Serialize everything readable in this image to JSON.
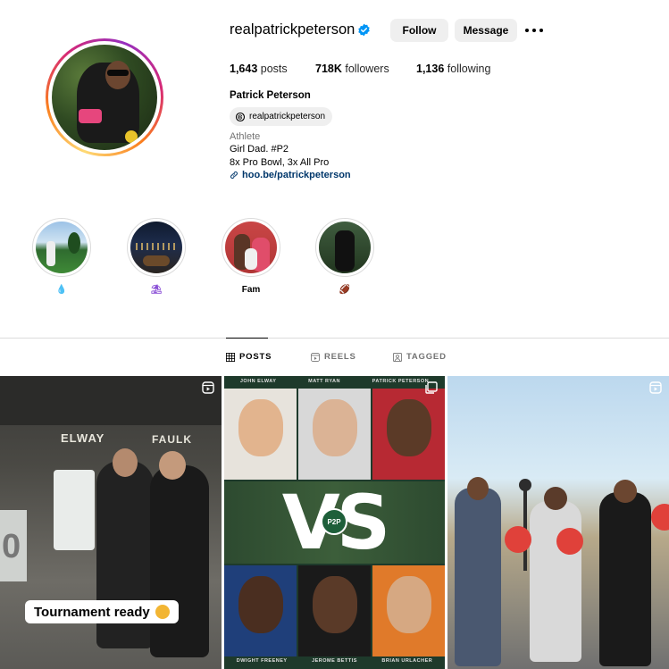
{
  "profile": {
    "username": "realpatrickpeterson",
    "verified": true,
    "follow_label": "Follow",
    "message_label": "Message",
    "stats": {
      "posts_count": "1,643",
      "posts_label": "posts",
      "followers_count": "718K",
      "followers_label": "followers",
      "following_count": "1,136",
      "following_label": "following"
    },
    "full_name": "Patrick Peterson",
    "threads_handle": "realpatrickpeterson",
    "category": "Athlete",
    "bio_line1": "Girl Dad. #P2",
    "bio_line2": "8x Pro Bowl, 3x All Pro",
    "link": "hoo.be/patrickpeterson"
  },
  "highlights": [
    {
      "label": "💧",
      "icon": "water-drop"
    },
    {
      "label": "⛱",
      "icon": "umbrella-emoji"
    },
    {
      "label": "Fam",
      "icon": "family-photo"
    },
    {
      "label": "🏈",
      "icon": "football-emoji"
    }
  ],
  "tabs": {
    "posts": "POSTS",
    "reels": "REELS",
    "tagged": "TAGGED",
    "active": "posts"
  },
  "posts": [
    {
      "type": "reel",
      "sign_left": "ELWAY",
      "sign_right": "FAULK",
      "wall_text": "0",
      "caption": "Tournament ready"
    },
    {
      "type": "reel",
      "top_names": [
        "JOHN ELWAY",
        "MATT RYAN",
        "PATRICK PETERSON"
      ],
      "bottom_names": [
        "DWIGHT FREENEY",
        "JEROME BETTIS",
        "BRIAN URLACHER"
      ],
      "vs_text": "VS",
      "badge_text": "P2P"
    },
    {
      "type": "reel"
    }
  ],
  "colors": {
    "link": "#00376b",
    "verified": "#0095f6",
    "button_bg": "#efefef",
    "divider": "#dbdbdb"
  }
}
